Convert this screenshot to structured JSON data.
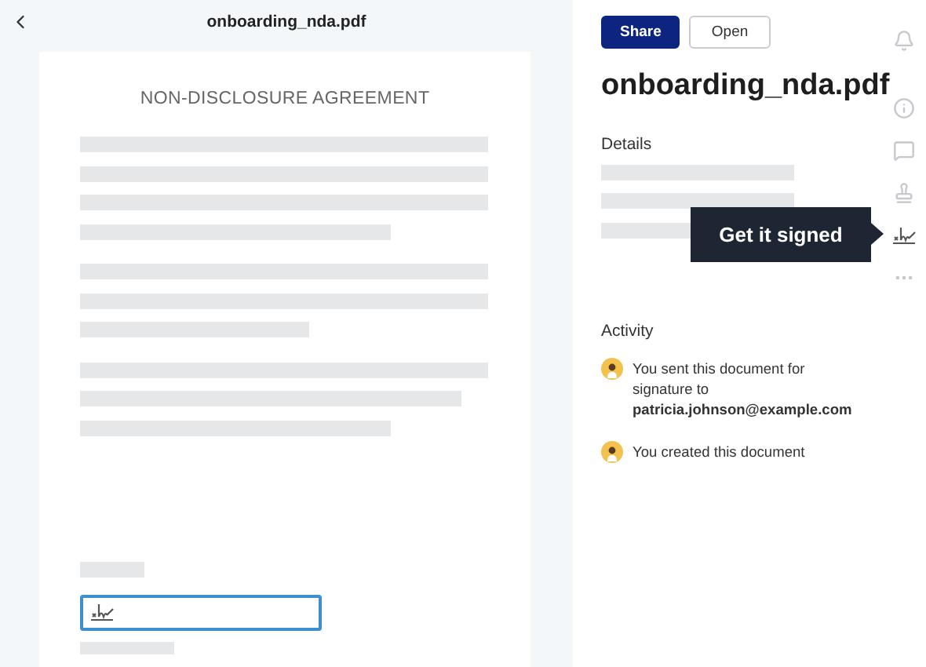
{
  "viewer": {
    "title": "onboarding_nda.pdf",
    "document_heading": "NON-DISCLOSURE AGREEMENT"
  },
  "actions": [
    {
      "label": "Share",
      "kind": "primary"
    },
    {
      "label": "Open",
      "kind": "secondary"
    }
  ],
  "file_title": "onboarding_nda.pdf",
  "details": {
    "heading": "Details"
  },
  "tooltip": "Get it signed",
  "rail": [
    {
      "kind": "bell",
      "selected": false
    },
    {
      "kind": "info",
      "selected": false
    },
    {
      "kind": "comment",
      "selected": false
    },
    {
      "kind": "stamp",
      "selected": false
    },
    {
      "kind": "signature",
      "selected": true
    },
    {
      "kind": "more",
      "selected": false
    }
  ],
  "activity": {
    "heading": "Activity",
    "items": [
      {
        "text": "You sent this document for signature to **patricia.johnson@example.com**"
      },
      {
        "text": "You created this document"
      }
    ]
  }
}
